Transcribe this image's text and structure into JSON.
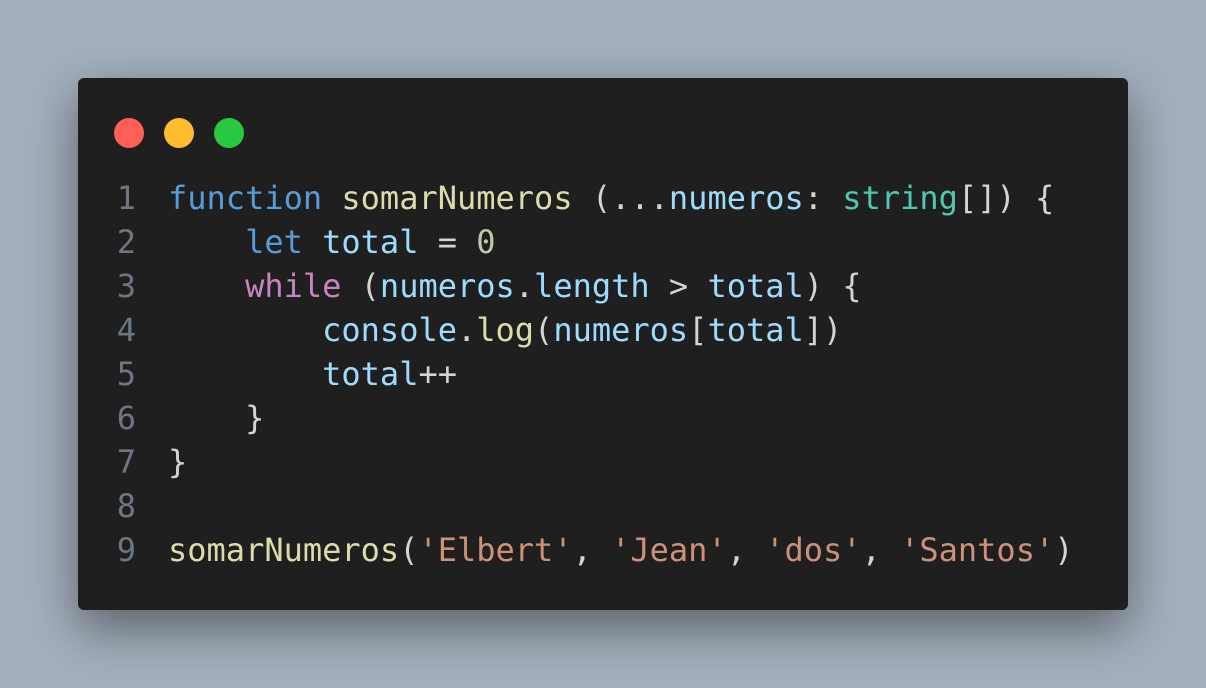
{
  "window": {
    "traffic_lights": {
      "close_color": "#ff5f57",
      "minimize_color": "#febc2e",
      "maximize_color": "#28c840"
    }
  },
  "code": {
    "lines": [
      {
        "number": "1",
        "tokens": [
          {
            "t": "function",
            "k": "kw"
          },
          {
            "t": " ",
            "k": "punc"
          },
          {
            "t": "somarNumeros",
            "k": "fn"
          },
          {
            "t": " (...",
            "k": "punc"
          },
          {
            "t": "numeros",
            "k": "var"
          },
          {
            "t": ": ",
            "k": "punc"
          },
          {
            "t": "string",
            "k": "type"
          },
          {
            "t": "[]) {",
            "k": "punc"
          }
        ]
      },
      {
        "number": "2",
        "tokens": [
          {
            "t": "    ",
            "k": "punc"
          },
          {
            "t": "let",
            "k": "kw"
          },
          {
            "t": " ",
            "k": "punc"
          },
          {
            "t": "total",
            "k": "var"
          },
          {
            "t": " = ",
            "k": "punc"
          },
          {
            "t": "0",
            "k": "num"
          }
        ]
      },
      {
        "number": "3",
        "tokens": [
          {
            "t": "    ",
            "k": "punc"
          },
          {
            "t": "while",
            "k": "ctrl"
          },
          {
            "t": " (",
            "k": "punc"
          },
          {
            "t": "numeros",
            "k": "var"
          },
          {
            "t": ".",
            "k": "punc"
          },
          {
            "t": "length",
            "k": "var"
          },
          {
            "t": " > ",
            "k": "punc"
          },
          {
            "t": "total",
            "k": "var"
          },
          {
            "t": ") {",
            "k": "punc"
          }
        ]
      },
      {
        "number": "4",
        "tokens": [
          {
            "t": "        ",
            "k": "punc"
          },
          {
            "t": "console",
            "k": "var"
          },
          {
            "t": ".",
            "k": "punc"
          },
          {
            "t": "log",
            "k": "fn"
          },
          {
            "t": "(",
            "k": "punc"
          },
          {
            "t": "numeros",
            "k": "var"
          },
          {
            "t": "[",
            "k": "punc"
          },
          {
            "t": "total",
            "k": "var"
          },
          {
            "t": "])",
            "k": "punc"
          }
        ]
      },
      {
        "number": "5",
        "tokens": [
          {
            "t": "        ",
            "k": "punc"
          },
          {
            "t": "total",
            "k": "var"
          },
          {
            "t": "++",
            "k": "punc"
          }
        ]
      },
      {
        "number": "6",
        "tokens": [
          {
            "t": "    ",
            "k": "punc"
          },
          {
            "t": "}",
            "k": "punc"
          }
        ]
      },
      {
        "number": "7",
        "tokens": [
          {
            "t": "}",
            "k": "punc"
          }
        ]
      },
      {
        "number": "8",
        "tokens": []
      },
      {
        "number": "9",
        "tokens": [
          {
            "t": "somarNumeros",
            "k": "fn"
          },
          {
            "t": "(",
            "k": "punc"
          },
          {
            "t": "'Elbert'",
            "k": "str"
          },
          {
            "t": ", ",
            "k": "punc"
          },
          {
            "t": "'Jean'",
            "k": "str"
          },
          {
            "t": ", ",
            "k": "punc"
          },
          {
            "t": "'dos'",
            "k": "str"
          },
          {
            "t": ", ",
            "k": "punc"
          },
          {
            "t": "'Santos'",
            "k": "str"
          },
          {
            "t": ")",
            "k": "punc"
          }
        ]
      }
    ]
  }
}
